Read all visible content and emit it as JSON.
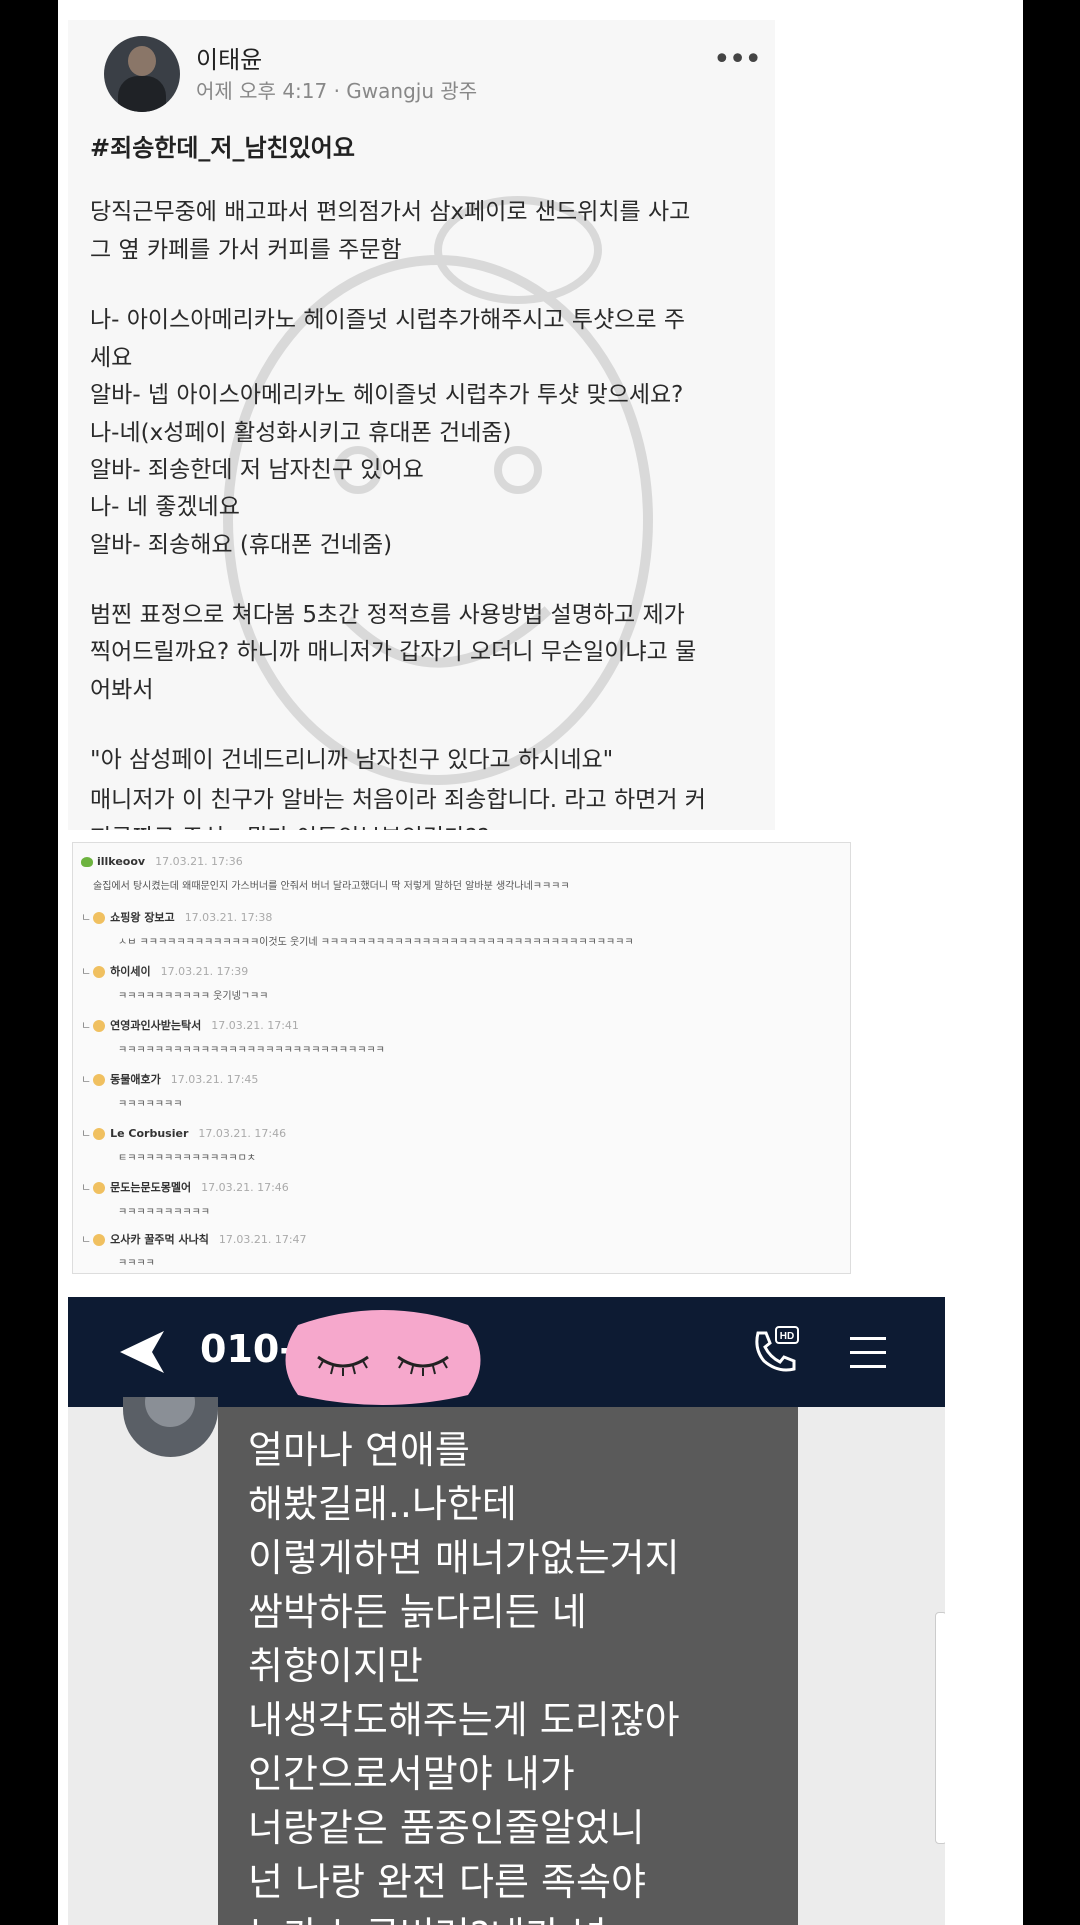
{
  "post": {
    "author": "이태윤",
    "meta": "어제 오후 4:17 · Gwangju 광주",
    "hashtag": "#죄송한데_저_남친있어요",
    "lines": [
      "당직근무중에 배고파서 편의점가서 삼x페이로 샌드위치를 사고",
      "그 옆 카페를 가서 커피를 주문함",
      "나- 아이스아메리카노 헤이즐넛 시럽추가해주시고 투샷으로 주",
      "세요",
      "알바- 넵 아이스아메리카노 헤이즐넛 시럽추가 투샷 맞으세요?",
      "나-네(x성페이 활성화시키고 휴대폰 건네줌)",
      "알바- 죄송한데 저 남자친구 있어요",
      "나- 네 좋겠네요",
      "알바- 죄송해요 (휴대폰 건네줌)",
      "범찐 표정으로 쳐다봄 5초간 정적흐름 사용방법 설명하고 제가",
      "찍어드릴까요? 하니까 매니저가 갑자기 오더니 무슨일이냐고 물",
      "어봐서",
      "\"아 삼성페이 건네드리니까 남자친구 있다고 하시네요\"",
      "매니저가 이 친구가 알바는 처음이라 죄송합니다. 라고 하면거 커",
      "피공짜로 주심.. 뭔가 이득인부분인건가??"
    ]
  },
  "comments": {
    "top": {
      "nick": "illkeoov",
      "time": "17.03.21. 17:36",
      "text": "술집에서 탕시켰는데 왜때문인지 가스버너를 안줘서 버너 달라고했더니 딱 저렇게 말하던 알바분 생각나네ㅋㅋㅋㅋ"
    },
    "replies": [
      {
        "nick": "쇼핑왕 장보고",
        "time": "17.03.21. 17:38",
        "text": "ㅅㅂ ㅋㅋㅋㅋㅋㅋㅋㅋㅋㅋㅋㅋㅋ이것도 웃기네 ㅋㅋㅋㅋㅋㅋㅋㅋㅋㅋㅋㅋㅋㅋㅋㅋㅋㅋㅋㅋㅋㅋㅋㅋㅋㅋㅋㅋㅋㅋㅋㅋㅋㅋ"
      },
      {
        "nick": "하이세이",
        "time": "17.03.21. 17:39",
        "text": "ㅋㅋㅋㅋㅋㅋㅋㅋㅋㅋ 웃기넹ㄱㅋㅋ"
      },
      {
        "nick": "연영과인사받는탁서",
        "time": "17.03.21. 17:41",
        "text": "ㅋㅋㅋㅋㅋㅋㅋㅋㅋㅋㅋㅋㅋㅋㅋㅋㅋㅋㅋㅋㅋㅋㅋㅋㅋㅋㅋㅋㅋ"
      },
      {
        "nick": "동물애호가",
        "time": "17.03.21. 17:45",
        "text": "ㅋㅋㅋㅋㅋㅋㅋ"
      },
      {
        "nick": "Le Corbusier",
        "time": "17.03.21. 17:46",
        "text": "ㅌㅋㅋㅋㅋㅋㅋㅋㅋㅋㅋㅋㅋㅁㅊ"
      },
      {
        "nick": "문도는문도몽멜어",
        "time": "17.03.21. 17:46",
        "text": "ㅋㅋㅋㅋㅋㅋㅋㅋㅋㅋ"
      },
      {
        "nick": "오사카 꿀주먹 사나칙",
        "time": "17.03.21. 17:47",
        "text": "ㅋㅋㅋㅋ"
      }
    ]
  },
  "chat": {
    "phone": "010-",
    "lines": [
      "얼마나 연애를",
      "해봤길래..나한테",
      "이렇게하면 매너가없는거지",
      "쌈박하든 늙다리든 네",
      "취향이지만",
      "내생각도해주는게 도리잖아",
      "인간으로서말야 내가",
      "너랑같은 품종인줄알었니",
      "넌 나랑 완전 다른 족속야",
      "누가 누굴버려?내가 널"
    ]
  }
}
